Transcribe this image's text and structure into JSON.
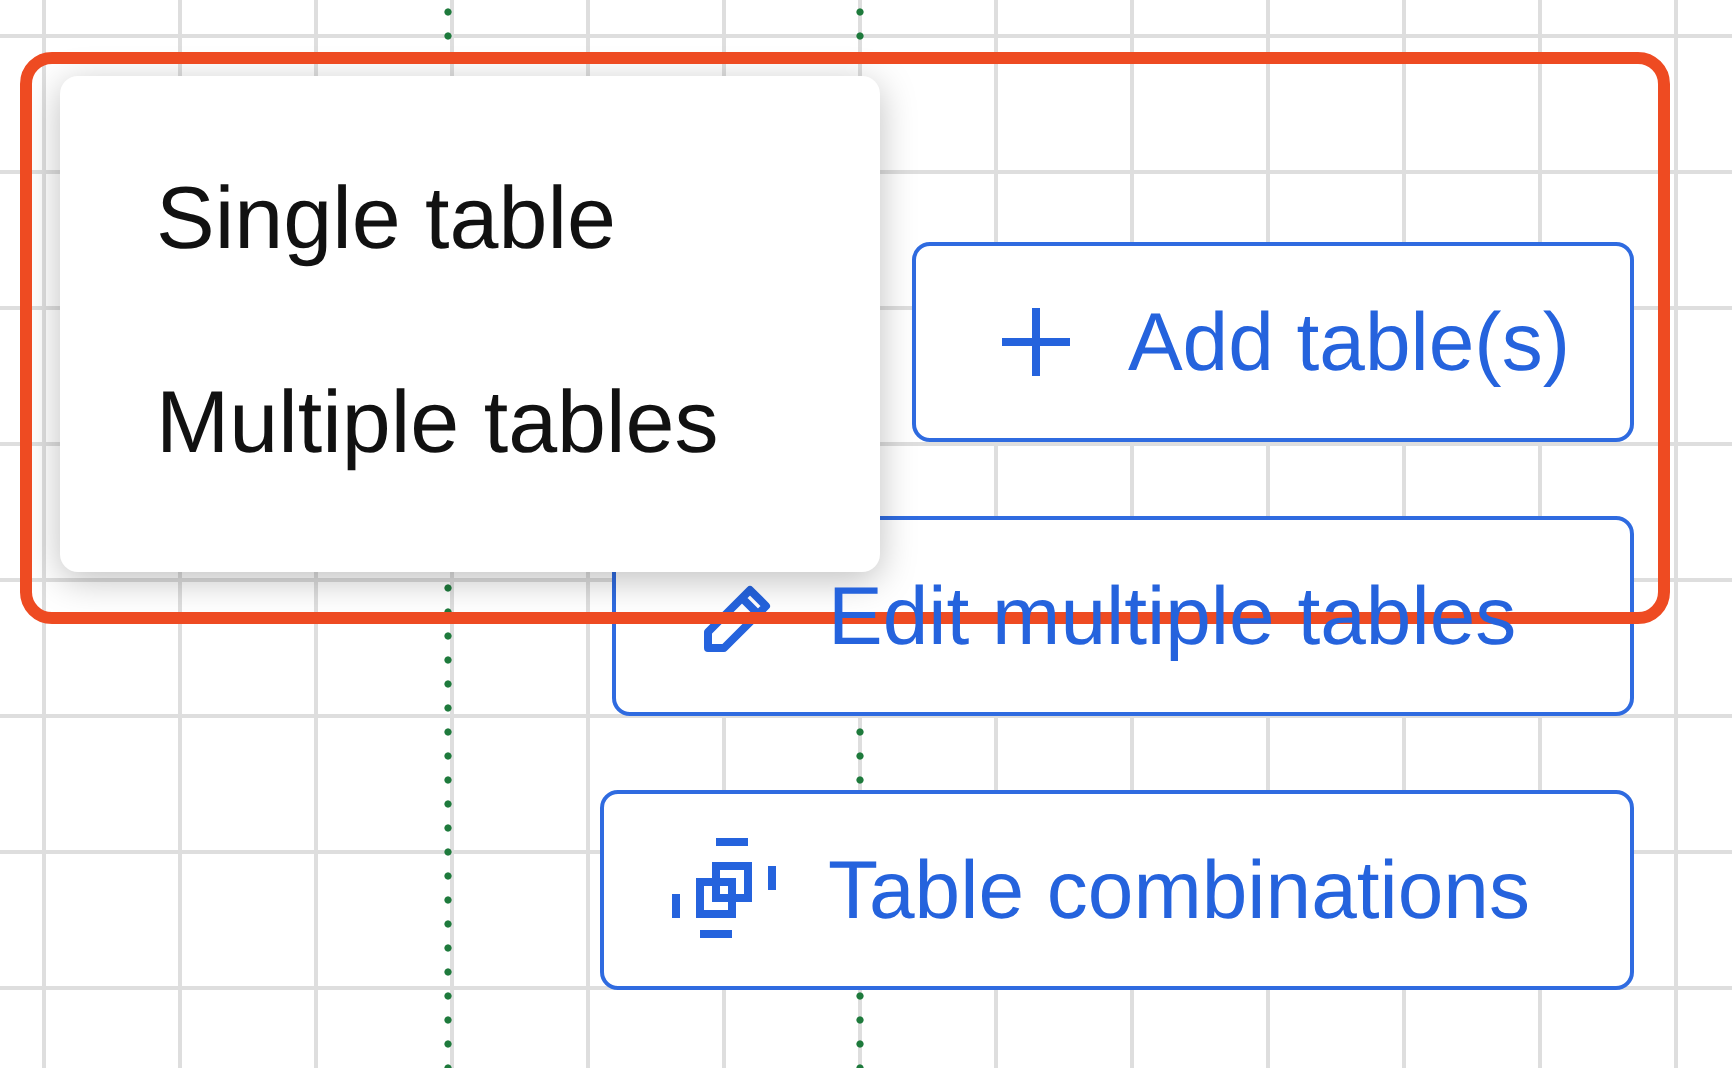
{
  "menu": {
    "items": [
      {
        "label": "Single table"
      },
      {
        "label": "Multiple tables"
      }
    ]
  },
  "buttons": [
    {
      "label": "Add table(s)"
    },
    {
      "label": "Edit multiple tables"
    },
    {
      "label": "Table combinations"
    }
  ]
}
